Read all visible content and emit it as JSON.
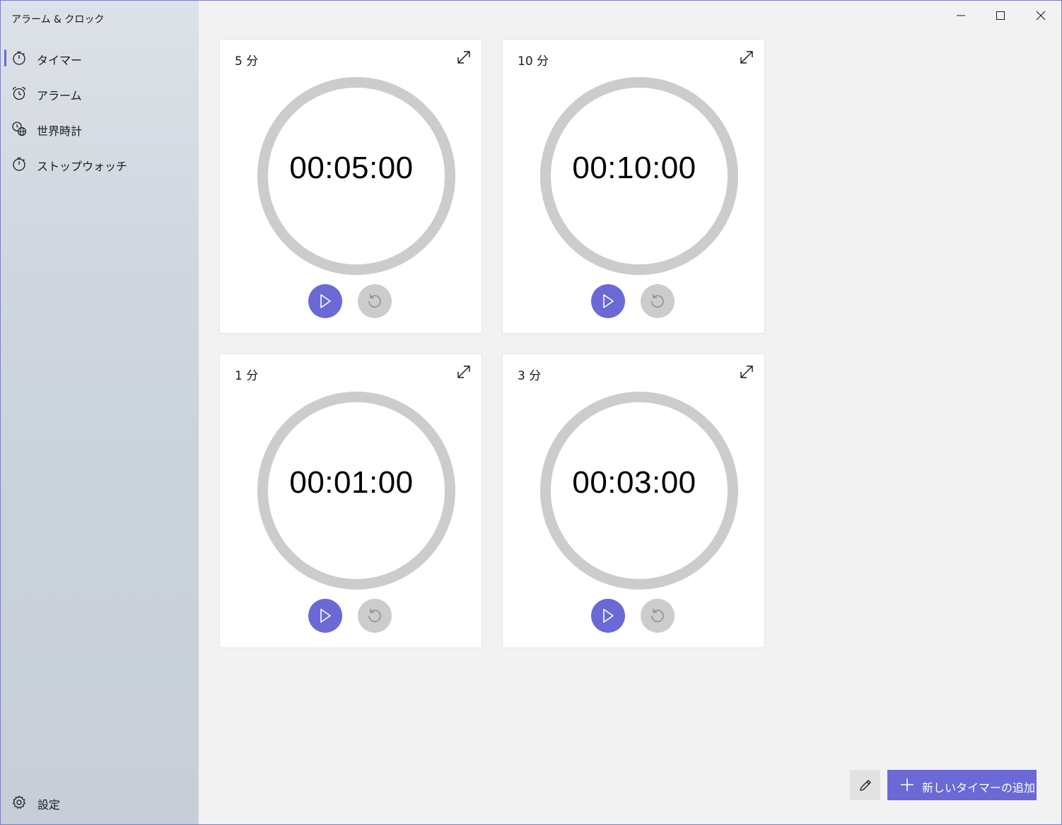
{
  "app": {
    "title": "アラーム & クロック"
  },
  "sidebar": {
    "items": [
      {
        "label": "タイマー",
        "icon": "timer-icon",
        "selected": true
      },
      {
        "label": "アラーム",
        "icon": "alarm-icon",
        "selected": false
      },
      {
        "label": "世界時計",
        "icon": "world-clock-icon",
        "selected": false
      },
      {
        "label": "ストップウォッチ",
        "icon": "stopwatch-icon",
        "selected": false
      }
    ],
    "settings_label": "設定"
  },
  "timers": [
    {
      "name": "5 分",
      "time": "00:05:00"
    },
    {
      "name": "10 分",
      "time": "00:10:00"
    },
    {
      "name": "1 分",
      "time": "00:01:00"
    },
    {
      "name": "3 分",
      "time": "00:03:00"
    }
  ],
  "actions": {
    "add_timer_label": "新しいタイマーの追加"
  },
  "colors": {
    "accent": "#6b69d6",
    "ring": "#cccccc",
    "reset": "#cccccc"
  }
}
